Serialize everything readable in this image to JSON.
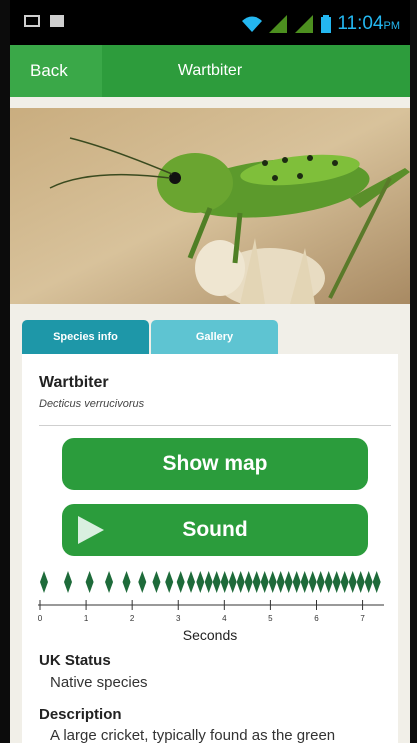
{
  "status_bar": {
    "time": "11:04",
    "ampm": "PM"
  },
  "app_bar": {
    "back_label": "Back",
    "title": "Wartbiter"
  },
  "hero": {
    "icon": "cricket-photo"
  },
  "tabs": [
    {
      "label": "Species info",
      "active": true
    },
    {
      "label": "Gallery",
      "active": false
    }
  ],
  "species": {
    "name": "Wartbiter",
    "latin": "Decticus verrucivorus"
  },
  "buttons": {
    "map_label": "Show map",
    "sound_label": "Sound"
  },
  "waveform": {
    "axis_label": "Seconds",
    "ticks": [
      "0",
      "1",
      "2",
      "3",
      "4",
      "5",
      "6",
      "7"
    ]
  },
  "uk_status": {
    "title": "UK Status",
    "value": "Native species"
  },
  "description": {
    "title": "Description",
    "text": "A large cricket, typically found as the green"
  },
  "colors": {
    "accent_green": "#2d9c3c",
    "tab_active": "#1e97a8",
    "tab_inactive": "#5ec4d2"
  }
}
